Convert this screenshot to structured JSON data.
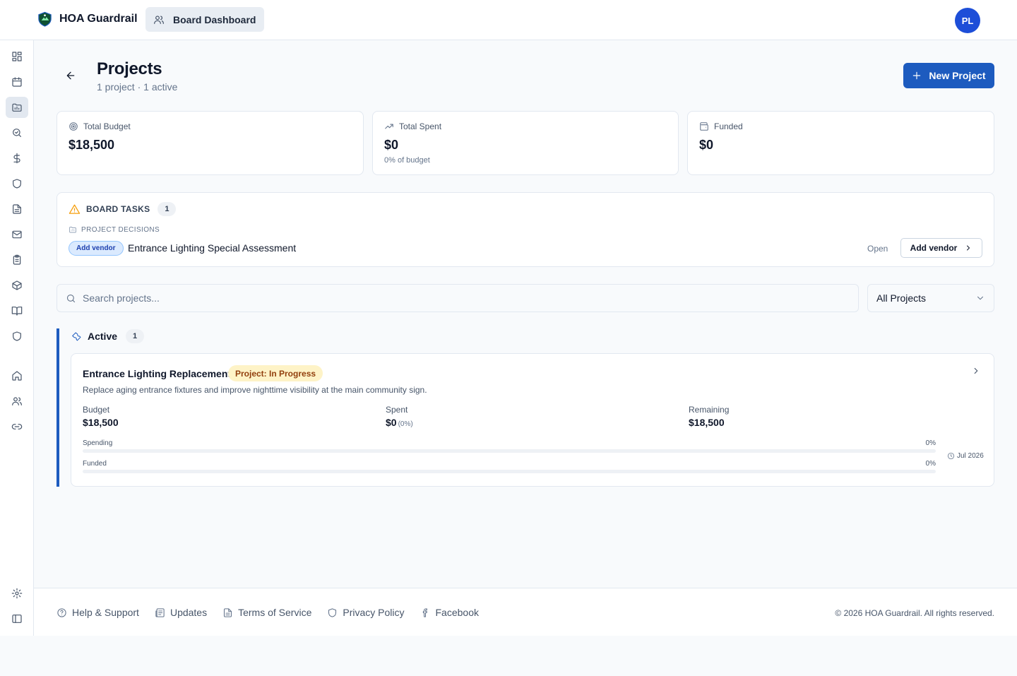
{
  "app": {
    "brand": "HOA Guardrail",
    "nav_label": "Board Dashboard",
    "avatar_initials": "PL",
    "accent_color": "#1d5bbf"
  },
  "sidebar": {
    "items": [
      {
        "icon": "dashboard-icon"
      },
      {
        "icon": "calendar-icon"
      },
      {
        "icon": "folder-chart-icon",
        "active": true
      },
      {
        "icon": "search-check-icon"
      },
      {
        "icon": "dollar-icon"
      },
      {
        "icon": "shield-icon"
      },
      {
        "icon": "document-icon"
      },
      {
        "icon": "mail-icon"
      },
      {
        "icon": "clipboard-icon"
      },
      {
        "icon": "package-icon"
      },
      {
        "icon": "book-icon"
      },
      {
        "icon": "shield-icon"
      },
      {
        "icon": "home-icon"
      },
      {
        "icon": "users-icon"
      },
      {
        "icon": "link-icon"
      }
    ],
    "bottom_items": [
      {
        "icon": "settings-icon"
      },
      {
        "icon": "sidebar-toggle-icon"
      }
    ]
  },
  "page": {
    "title": "Projects",
    "subtitle": "1 project · 1 active",
    "new_button": "New Project"
  },
  "stats": {
    "total_budget": {
      "label": "Total Budget",
      "value": "$18,500"
    },
    "total_spent": {
      "label": "Total Spent",
      "value": "$0",
      "note": "0% of budget"
    },
    "funded": {
      "label": "Funded",
      "value": "$0"
    }
  },
  "board_tasks": {
    "title": "BOARD TASKS",
    "count": "1",
    "section": "PROJECT DECISIONS",
    "task": {
      "tag": "Add vendor",
      "name": "Entrance Lighting Special Assessment",
      "status": "Open",
      "action": "Add vendor"
    }
  },
  "filters": {
    "search_placeholder": "Search projects...",
    "select_value": "All Projects"
  },
  "groups": [
    {
      "name": "Active",
      "count": "1",
      "projects": [
        {
          "title": "Entrance Lighting Replacement",
          "status": "Project: In Progress",
          "description": "Replace aging entrance fixtures and improve nighttime visibility at the main community sign.",
          "budget_label": "Budget",
          "budget": "$18,500",
          "spent_label": "Spent",
          "spent": "$0",
          "spent_pct": "(0%)",
          "remaining_label": "Remaining",
          "remaining": "$18,500",
          "spending_label": "Spending",
          "spending_pct": "0%",
          "spending_fraction": 0,
          "funded_label": "Funded",
          "funded_pct": "0%",
          "funded_fraction": 0,
          "due": "Jul 2026"
        }
      ]
    }
  ],
  "footer": {
    "links": [
      {
        "label": "Help & Support",
        "icon": "help-icon"
      },
      {
        "label": "Updates",
        "icon": "newspaper-icon"
      },
      {
        "label": "Terms of Service",
        "icon": "document-icon"
      },
      {
        "label": "Privacy Policy",
        "icon": "shield-icon"
      },
      {
        "label": "Facebook",
        "icon": "facebook-icon"
      }
    ],
    "copyright": "© 2026 HOA Guardrail. All rights reserved."
  }
}
